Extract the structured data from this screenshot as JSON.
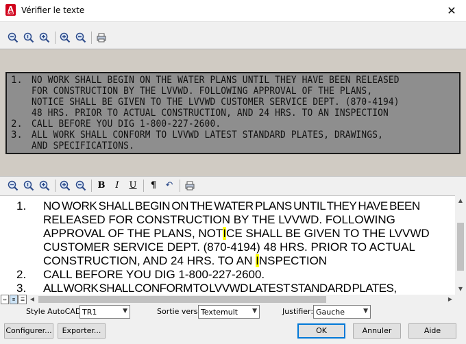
{
  "window": {
    "title": "Vérifier le texte",
    "app_icon_letter": "A",
    "app_icon_sub": "ACD"
  },
  "icons": {
    "close": "✕",
    "pilcrow": "¶",
    "bold": "B",
    "italic": "I",
    "underline": "U",
    "undo": "↶",
    "scroll_up": "▲",
    "scroll_down": "▼",
    "scroll_left": "◀",
    "scroll_right": "▶",
    "dropdown": "▼"
  },
  "preview": {
    "numbers": [
      "1.",
      "2.",
      "3."
    ],
    "lines": [
      "NO WORK SHALL BEGIN ON THE WATER PLANS UNTIL THEY HAVE BEEN RELEASED",
      "FOR CONSTRUCTION BY THE LVVWD.  FOLLOWING APPROVAL OF THE PLANS,",
      "NOTICE SHALL BE GIVEN TO THE LVVWD CUSTOMER SERVICE DEPT. (870-4194)",
      "48 HRS. PRIOR TO ACTUAL CONSTRUCTION, AND 24 HRS. TO AN INSPECTION",
      "CALL BEFORE YOU DIG 1-800-227-2600.",
      "ALL WORK SHALL CONFORM TO LVVWD LATEST STANDARD PLATES, DRAWINGS,",
      "AND SPECIFICATIONS."
    ]
  },
  "editor": {
    "numbers": [
      "1.",
      "2.",
      "3."
    ],
    "line1": "NO WORK SHALL BEGIN ON THE WATER PLANS UNTIL THEY HAVE BEEN",
    "line2": "RELEASED FOR CONSTRUCTION BY THE LVVWD. FOLLOWING",
    "line3_a": "APPROVAL OF THE PLANS, NOT",
    "line3_hl": "I",
    "line3_b": "CE SHALL BE GIVEN TO THE LVVWD",
    "line4": "CUSTOMER SERVICE DEPT. (870-4194) 48 HRS. PRIOR TO ACTUAL",
    "line5_a": "CONSTRUCTION, AND 24 HRS. TO AN ",
    "line5_hl": "I",
    "line5_b": "NSPECTION",
    "line6": "CALL BEFORE YOU DIG 1-800-227-2600.",
    "line7": "ALL WORK SHALL CONFORM TO LVVWD LATEST STANDARD PLATES,"
  },
  "options": {
    "style_label": "Style AutoCAD:",
    "style_value": "TR1",
    "output_label": "Sortie vers:",
    "output_value": "Textemult",
    "justify_label": "Justifier:",
    "justify_value": "Gauche"
  },
  "buttons": {
    "configure": "Configurer...",
    "export": "Exporter...",
    "ok": "OK",
    "cancel": "Annuler",
    "help": "Aide"
  },
  "colors": {
    "highlight": "#ffff00",
    "accent": "#0078d7",
    "app_icon": "#d0021b"
  }
}
